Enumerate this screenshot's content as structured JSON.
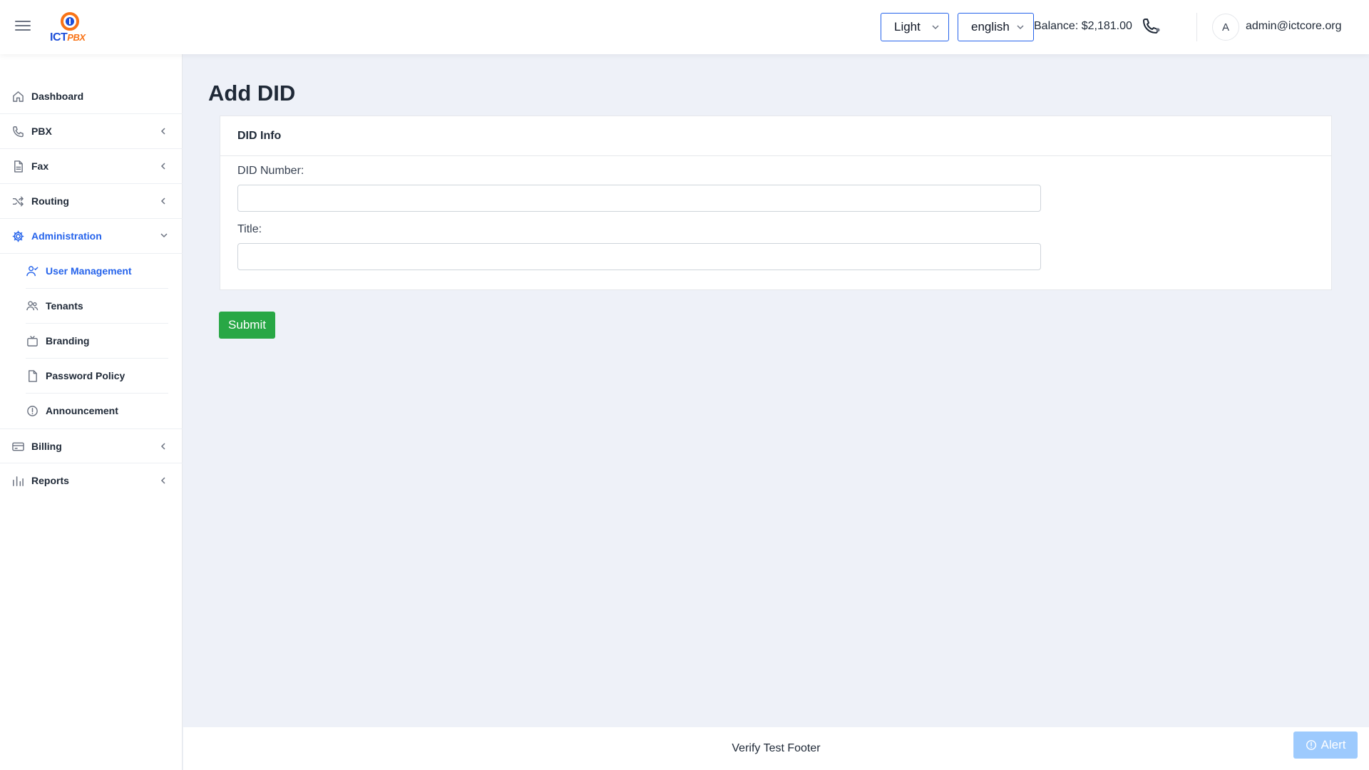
{
  "header": {
    "logo": {
      "text_ict": "ICT",
      "text_pbx": "PBX"
    },
    "theme_select": {
      "value": "Light",
      "options": [
        "Light"
      ]
    },
    "language_select": {
      "value": "english",
      "options": [
        "english"
      ]
    },
    "balance": "Balance: $2,181.00",
    "avatar_initial": "A",
    "user_email": "admin@ictcore.org"
  },
  "sidebar": {
    "items": [
      {
        "label": "Dashboard",
        "icon": "home-icon"
      },
      {
        "label": "PBX",
        "icon": "phone-icon",
        "expandable": true
      },
      {
        "label": "Fax",
        "icon": "document-icon",
        "expandable": true
      },
      {
        "label": "Routing",
        "icon": "shuffle-icon",
        "expandable": true
      },
      {
        "label": "Administration",
        "icon": "gear-icon",
        "expandable": true,
        "expanded": true,
        "active": true,
        "children": [
          {
            "label": "User Management",
            "icon": "user-check-icon",
            "active": true
          },
          {
            "label": "Tenants",
            "icon": "users-icon"
          },
          {
            "label": "Branding",
            "icon": "tv-icon"
          },
          {
            "label": "Password Policy",
            "icon": "file-icon"
          },
          {
            "label": "Announcement",
            "icon": "alert-circle-icon"
          }
        ]
      },
      {
        "label": "Billing",
        "icon": "credit-card-icon",
        "expandable": true
      },
      {
        "label": "Reports",
        "icon": "bar-chart-icon",
        "expandable": true
      }
    ]
  },
  "main": {
    "page_title": "Add DID",
    "card": {
      "title": "DID Info",
      "fields": [
        {
          "label": "DID Number:",
          "value": "",
          "placeholder": ""
        },
        {
          "label": "Title:",
          "value": "",
          "placeholder": ""
        }
      ]
    },
    "submit_label": "Submit"
  },
  "footer": {
    "text": "Verify Test Footer"
  },
  "alert_button": {
    "label": "Alert",
    "icon": "alert-circle-icon"
  },
  "colors": {
    "accent": "#2563eb",
    "submit": "#28a745",
    "background": "#eef1f8",
    "alert": "#93c5fd"
  }
}
